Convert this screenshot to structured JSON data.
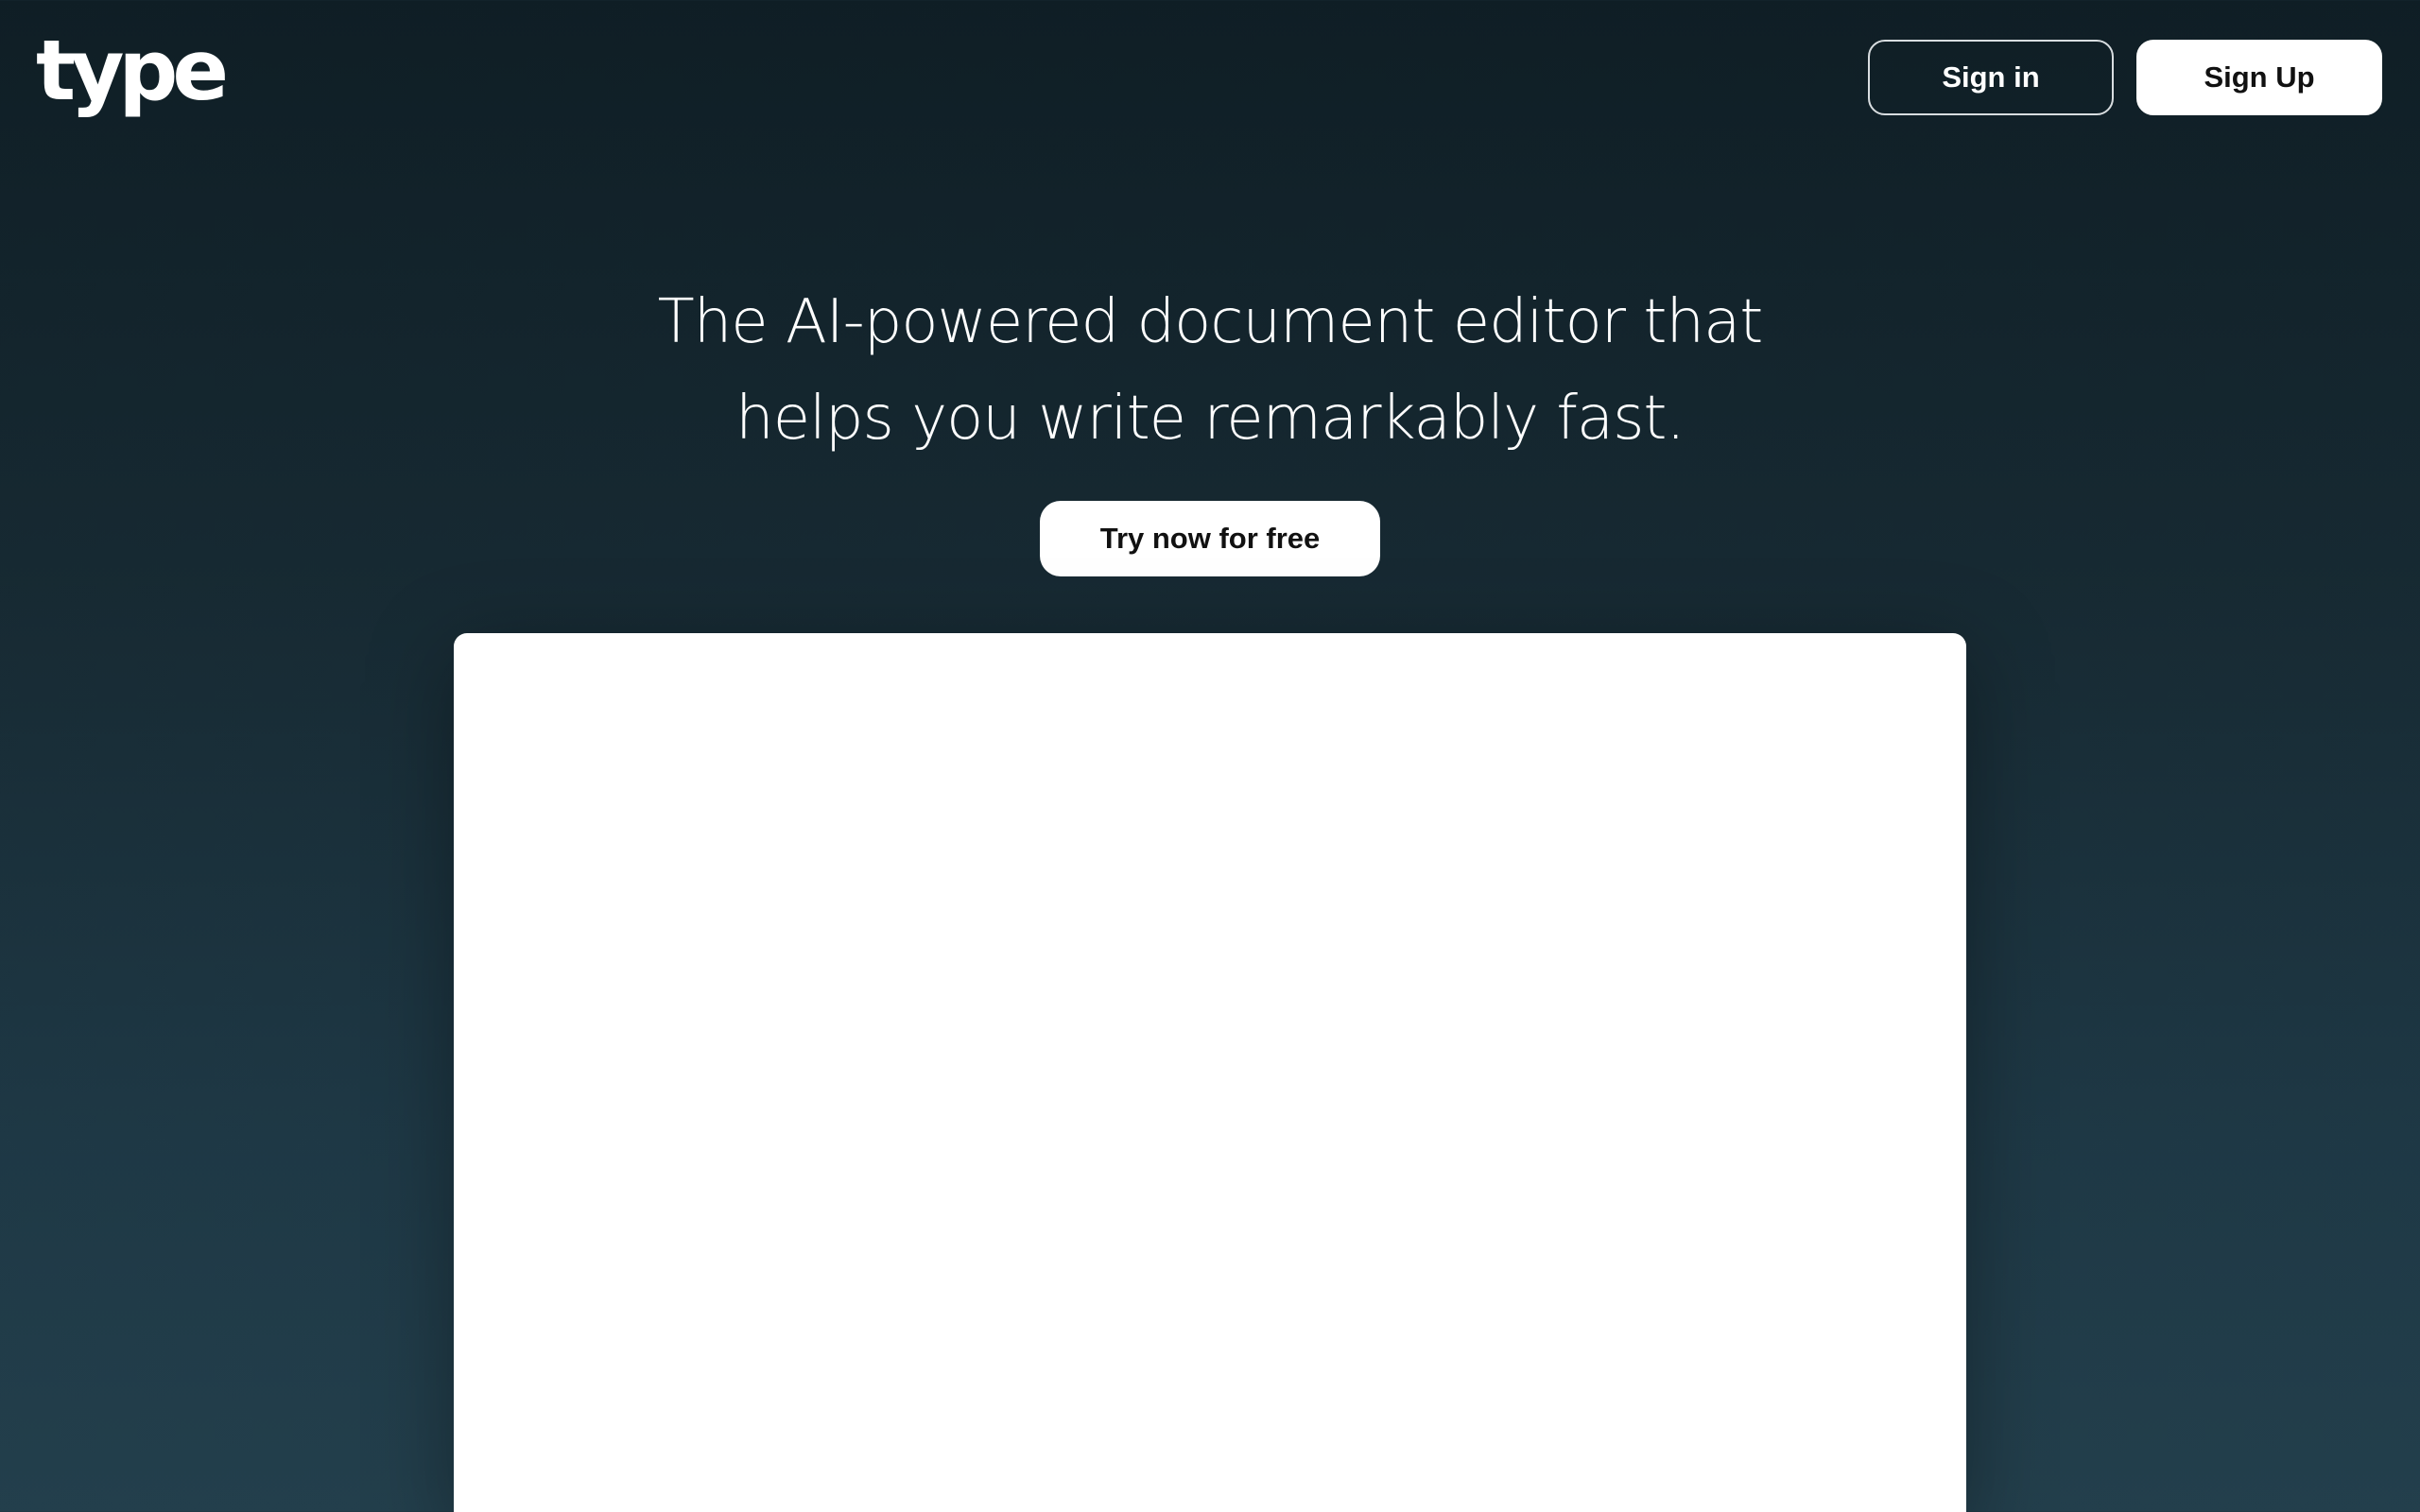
{
  "header": {
    "logo_text": "type",
    "sign_in_label": "Sign in",
    "sign_up_label": "Sign Up"
  },
  "hero": {
    "headline_line1": "The AI-powered document editor that",
    "headline_line2": "helps you write remarkably fast.",
    "cta_label": "Try now for free"
  },
  "colors": {
    "background_top": "#0f1e25",
    "background_bottom": "#233f4c",
    "button_bg": "#ffffff",
    "text_light": "#ffffff",
    "text_dark": "#111111"
  }
}
